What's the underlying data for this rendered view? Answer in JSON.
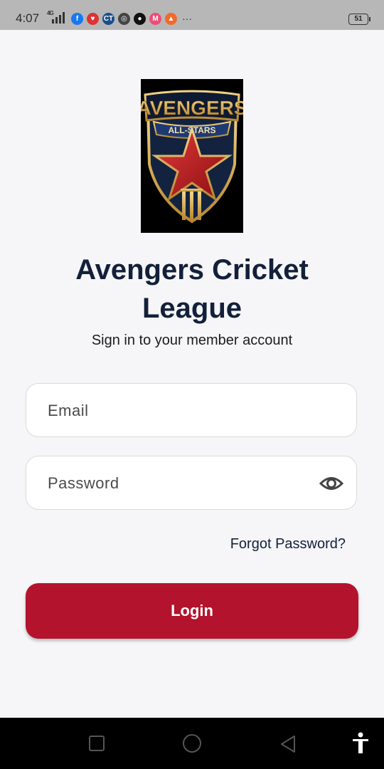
{
  "status_bar": {
    "time": "4:07",
    "network": "4G",
    "battery": "51",
    "more": "···",
    "app_icons": [
      {
        "name": "facebook-icon",
        "glyph": "f",
        "color": "#1877f2"
      },
      {
        "name": "app-icon-2",
        "glyph": "♥",
        "color": "#d33"
      },
      {
        "name": "ct-icon",
        "glyph": "CT",
        "color": "#1a4f8b"
      },
      {
        "name": "app-icon-4",
        "glyph": "◎",
        "color": "#444"
      },
      {
        "name": "app-icon-5",
        "glyph": "●",
        "color": "#111"
      },
      {
        "name": "myntra-icon",
        "glyph": "M",
        "color": "#e94e77"
      },
      {
        "name": "app-icon-7",
        "glyph": "▲",
        "color": "#f06a2b"
      }
    ]
  },
  "logo": {
    "line1": "AVENGERS",
    "line2": "ALL-STARS"
  },
  "title": "Avengers Cricket League",
  "subtitle": "Sign in to your member account",
  "form": {
    "email_placeholder": "Email",
    "password_placeholder": "Password",
    "forgot_password": "Forgot Password?",
    "login_label": "Login"
  },
  "colors": {
    "primary": "#b3132c",
    "title": "#13203a",
    "background": "#f6f6f8"
  }
}
